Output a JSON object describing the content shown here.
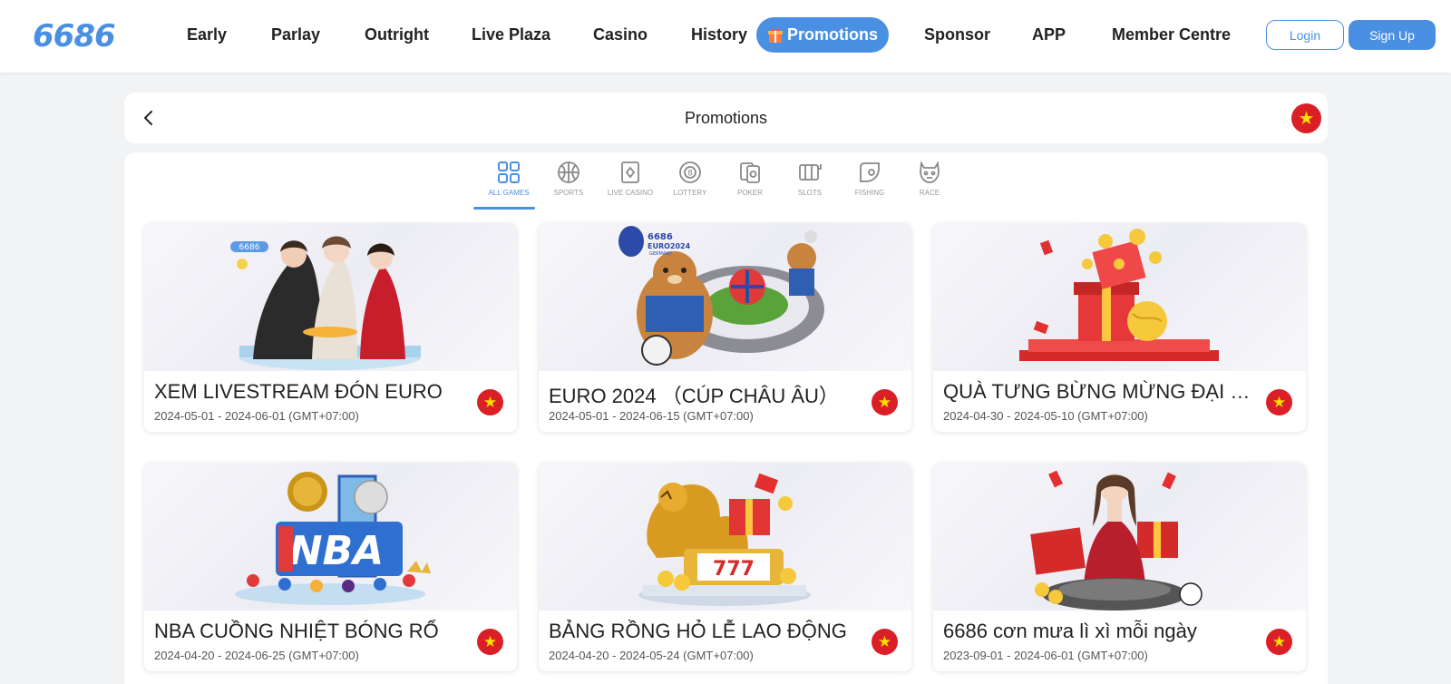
{
  "header": {
    "logo": "6686",
    "nav": [
      "Early",
      "Parlay",
      "Outright",
      "Live Plaza",
      "Casino",
      "History"
    ],
    "active_nav": "Promotions",
    "nav_after": [
      "Sponsor",
      "APP",
      "Member Centre"
    ],
    "login_label": "Login",
    "signup_label": "Sign Up"
  },
  "titlebar": {
    "title": "Promotions",
    "flag_symbol": "★"
  },
  "categories": [
    {
      "label": "ALL GAMES",
      "icon": "grid-icon",
      "active": true
    },
    {
      "label": "SPORTS",
      "icon": "basketball-icon",
      "active": false
    },
    {
      "label": "LIVE CASINO",
      "icon": "card-icon",
      "active": false
    },
    {
      "label": "LOTTERY",
      "icon": "lottery-ball-icon",
      "active": false
    },
    {
      "label": "POKER",
      "icon": "poker-icon",
      "active": false
    },
    {
      "label": "SLOTS",
      "icon": "slot-machine-icon",
      "active": false
    },
    {
      "label": "FISHING",
      "icon": "fishing-icon",
      "active": false
    },
    {
      "label": "RACE",
      "icon": "race-icon",
      "active": false
    }
  ],
  "promotions": [
    {
      "title": "XEM LIVESTREAM ĐÓN EURO",
      "date": "2024-05-01 - 2024-06-01 (GMT+07:00)"
    },
    {
      "title": "EURO 2024 （CÚP CHÂU ÂU）",
      "date": "2024-05-01 - 2024-06-15 (GMT+07:00)"
    },
    {
      "title": "QUÀ TƯNG BỪNG MỪNG ĐẠI LỄ...",
      "date": "2024-04-30 - 2024-05-10 (GMT+07:00)"
    },
    {
      "title": "NBA CUỒNG NHIỆT BÓNG RỔ",
      "date": "2024-04-20 - 2024-06-25 (GMT+07:00)"
    },
    {
      "title": "BẢNG RỒNG HỎ LỄ LAO ĐỘNG",
      "date": "2024-04-20 - 2024-05-24 (GMT+07:00)"
    },
    {
      "title": "6686 cơn mưa lì xì mỗi ngày",
      "date": "2023-09-01 - 2024-06-01 (GMT+07:00)"
    }
  ],
  "banner_texts": {
    "card1_logo": "6686",
    "card2_logo": "6686",
    "card2_sub": "EURO2024",
    "card2_sub2": "GERMANY",
    "card4_text": "NBA",
    "card5_text": "777"
  },
  "colors": {
    "accent": "#4a90e2",
    "flag_red": "#da1f26",
    "flag_star": "#ffde00"
  }
}
